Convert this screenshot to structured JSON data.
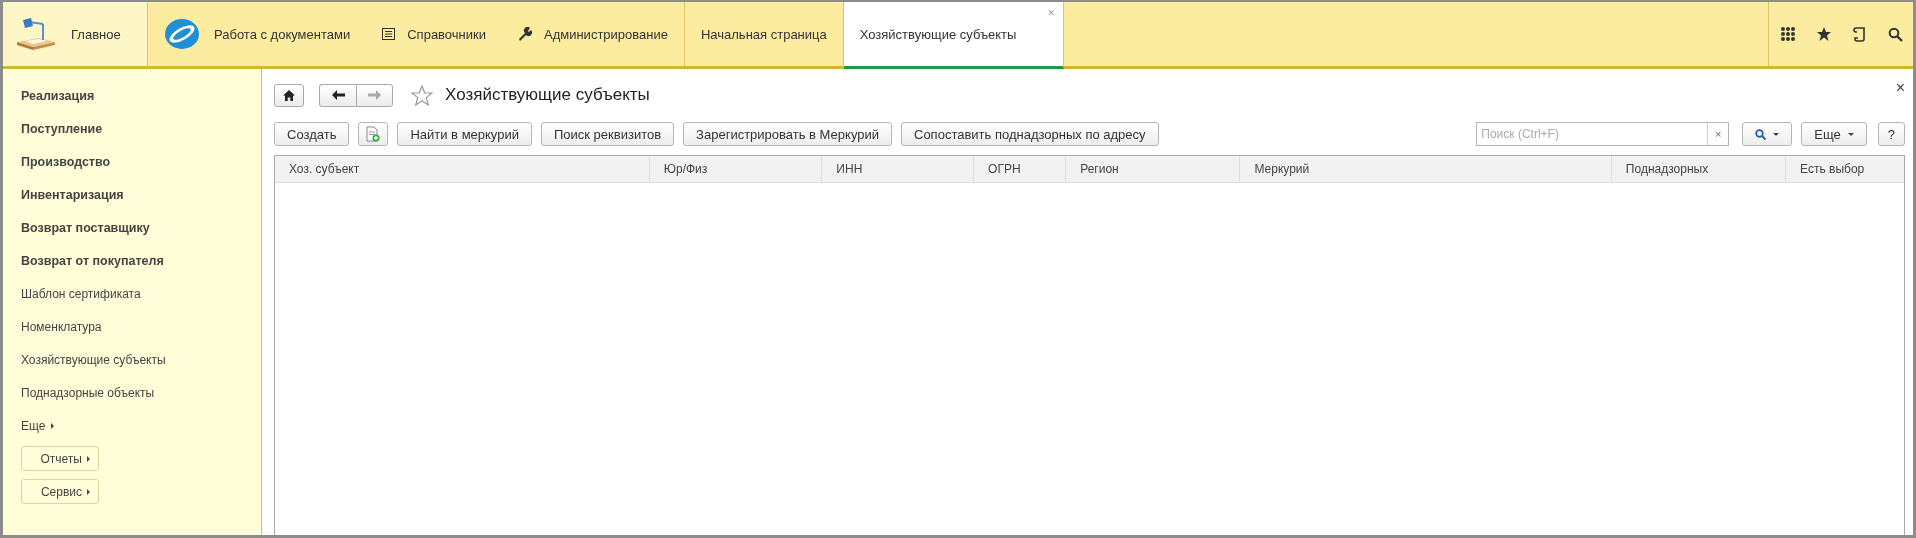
{
  "sections": [
    {
      "label": "Главное",
      "kind": "home"
    },
    {
      "label": "Работа с документами",
      "kind": "logo"
    },
    {
      "label": "Справочники",
      "kind": "list"
    },
    {
      "label": "Администрирование",
      "kind": "wrench"
    }
  ],
  "tabs": [
    {
      "label": "Начальная страница",
      "selected": false
    },
    {
      "label": "Хозяйствующие субъекты",
      "selected": true,
      "close": "×"
    }
  ],
  "sidebar": {
    "items": [
      {
        "label": "Реализация",
        "kind": "bold"
      },
      {
        "label": "Поступление",
        "kind": "bold"
      },
      {
        "label": "Производство",
        "kind": "bold"
      },
      {
        "label": "Инвентаризация",
        "kind": "bold"
      },
      {
        "label": "Возврат поставщику",
        "kind": "bold"
      },
      {
        "label": "Возврат от покупателя",
        "kind": "bold"
      },
      {
        "label": "Шаблон сертификата",
        "kind": "plain"
      },
      {
        "label": "Номенклатура",
        "kind": "plain"
      },
      {
        "label": "Хозяйствующие субъекты",
        "kind": "plain"
      },
      {
        "label": "Поднадзорные объекты",
        "kind": "plain"
      },
      {
        "label": "Еще",
        "kind": "more"
      },
      {
        "label": "Отчеты",
        "kind": "button"
      },
      {
        "label": "Сервис",
        "kind": "button"
      }
    ]
  },
  "form": {
    "title": "Хозяйствующие субъекты",
    "buttons": [
      {
        "label": "Создать",
        "kind": "text"
      },
      {
        "kind": "copy"
      },
      {
        "label": "Найти в меркурий",
        "kind": "text"
      },
      {
        "label": "Поиск реквизитов",
        "kind": "text"
      },
      {
        "label": "Зарегистрировать в Меркурий",
        "kind": "text"
      },
      {
        "label": "Сопоставить поднадзорных по адресу",
        "kind": "text"
      }
    ],
    "search": {
      "placeholder": "Поиск (Ctrl+F)",
      "clear": "×"
    },
    "more_button": "Еще",
    "help_button": "?",
    "close": "×",
    "table": {
      "columns": [
        {
          "label": "Хоз. субъект"
        },
        {
          "label": "Юр/Физ"
        },
        {
          "label": "ИНН"
        },
        {
          "label": "ОГРН"
        },
        {
          "label": "Регион"
        },
        {
          "label": "Меркурий"
        },
        {
          "label": "Поднадзорных"
        },
        {
          "label": "Есть выбор"
        }
      ]
    }
  }
}
